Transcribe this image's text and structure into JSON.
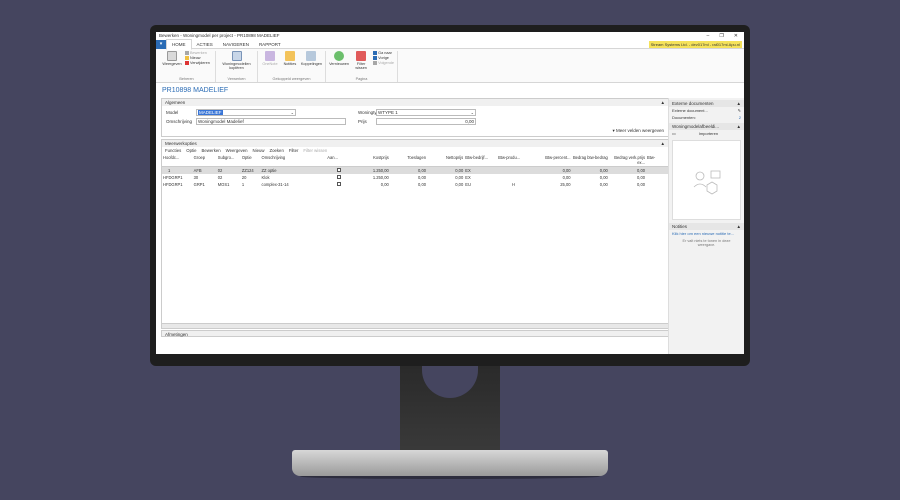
{
  "window": {
    "title": "Bewerken - Woningmodel per project - PR10898 MADELIEF",
    "controls": [
      "–",
      "❐",
      "✕"
    ]
  },
  "ribbon": {
    "file_label": "▾",
    "tabs": [
      "HOME",
      "ACTIES",
      "NAVIGEREN",
      "RAPPORT"
    ],
    "company": "Stream Systems Ltd. - dev017ml - ral017ml.Apu.nl",
    "groups": {
      "beheren": {
        "label": "Beheren",
        "view": "Weergeven",
        "small": [
          "Bewerken",
          "Nieuw",
          "Verwijderen"
        ]
      },
      "verwerken": {
        "label": "Verwerken",
        "copy": "Woningmodellen kopiëren"
      },
      "gekoppeld": {
        "label": "Gekoppeld weergeven",
        "buttons": [
          "OneNote",
          "Notities",
          "Koppelingen"
        ]
      },
      "pagina": {
        "label": "Pagina",
        "refresh": "Vernieuwen",
        "clear_filter": "Filter wissen",
        "small": [
          "Ga naar",
          "Vorige",
          "Volgende"
        ]
      }
    }
  },
  "page_title": "PR10898 MADELIEF",
  "general": {
    "header": "Algemeen",
    "model_label": "Model",
    "model_value": "MADELIEF",
    "woningtype_label": "Woningtype",
    "woningtype_value": "WTYPE 1",
    "omschrijving_label": "Omschrijving",
    "omschrijving_value": "Woningmodel Madelief",
    "prijs_label": "Prijs",
    "prijs_value": "0,00",
    "more_fields": "Meer velden weergeven"
  },
  "meerwerk": {
    "header": "Meerwerkopties",
    "actions": [
      "Functies",
      "Optie",
      "Bewerken",
      "Weergeven",
      "Nieuw",
      "Zoeken",
      "Filter",
      "Filter wissen"
    ],
    "columns": [
      "Hoofdc...",
      "Groep",
      "Subgro...",
      "Optie",
      "Omschrijving",
      "Aan...",
      "Kostprijs",
      "Toeslagen",
      "Nettoprijs",
      "Btw-bedrijf...",
      "Btw-produ...",
      "Btw-percent...",
      "Bedrag btw-bedrag",
      "Bedrag verk.prijs ex...",
      "Btw-"
    ],
    "rows": [
      [
        "1",
        "AFB",
        "02",
        "ZZ124",
        "ZZ optie",
        "",
        "1.250,00",
        "0,00",
        "0,00",
        "EX",
        "",
        "0,00",
        "0,00",
        "0,00",
        ""
      ],
      [
        "HFDGRP1",
        "30",
        "02",
        "20",
        "Klok",
        "",
        "1.250,00",
        "0,00",
        "0,00",
        "EX",
        "",
        "0,00",
        "0,00",
        "0,00",
        ""
      ],
      [
        "HFDGRP1",
        "GRP1",
        "MOS1",
        "1",
        "complex-31-14",
        "",
        "0,00",
        "0,00",
        "0,00",
        "EU",
        "H",
        "25,00",
        "0,00",
        "0,00",
        ""
      ]
    ]
  },
  "factbox": {
    "ext_docs_header": "Externe documenten",
    "ext_doc_label": "Externe document...",
    "documents_label": "Documenten:",
    "documents_value": "2",
    "picture_header": "Woningmodelafbeeldi...",
    "import_label": "Importeren",
    "notes_header": "Notities",
    "notes_link": "Klik hier om een nieuwe notitie te...",
    "notes_empty": "Er valt niets te tonen in deze weergave.",
    "collapse_icon": "▲"
  },
  "bottom_tab": "Afmetingen",
  "colors": {
    "accent": "#2b6cb5",
    "selection": "#3875d7",
    "badge": "#f5e25a",
    "background": "#45455f"
  }
}
